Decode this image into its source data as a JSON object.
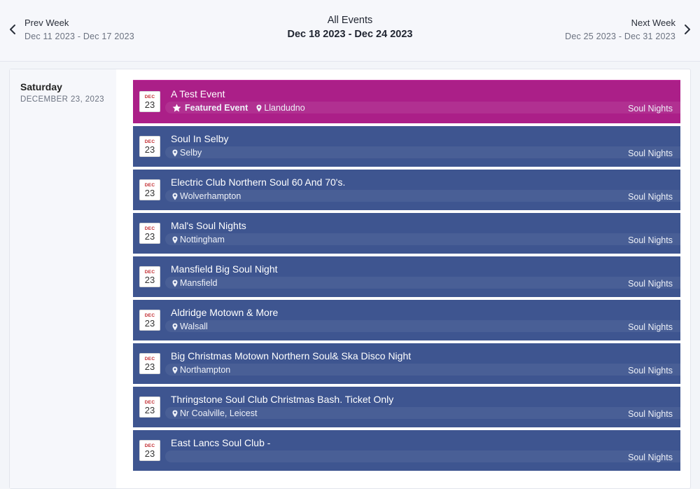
{
  "header": {
    "prev": {
      "label": "Prev Week",
      "range": "Dec 11 2023 - Dec 17 2023"
    },
    "current": {
      "label": "All Events",
      "range": "Dec 18 2023 - Dec 24 2023"
    },
    "next": {
      "label": "Next Week",
      "range": "Dec 25 2023 - Dec 31 2023"
    }
  },
  "day": {
    "name": "Saturday",
    "date": "DECEMBER 23, 2023"
  },
  "featured_label": "Featured Event",
  "colors": {
    "featured": "#ab1f88",
    "event": "#3e5590",
    "calendar_month": "#c0282d"
  },
  "events": [
    {
      "month": "DEC",
      "day": "23",
      "title": "A Test Event",
      "location": "Llandudno",
      "category": "Soul Nights",
      "featured": true
    },
    {
      "month": "DEC",
      "day": "23",
      "title": "Soul In Selby",
      "location": "Selby",
      "category": "Soul Nights",
      "featured": false
    },
    {
      "month": "DEC",
      "day": "23",
      "title": "Electric Club Northern Soul 60 And 70's.",
      "location": "Wolverhampton",
      "category": "Soul Nights",
      "featured": false
    },
    {
      "month": "DEC",
      "day": "23",
      "title": "Mal's Soul Nights",
      "location": "Nottingham",
      "category": "Soul Nights",
      "featured": false
    },
    {
      "month": "DEC",
      "day": "23",
      "title": "Mansfield Big Soul Night",
      "location": "Mansfield",
      "category": "Soul Nights",
      "featured": false
    },
    {
      "month": "DEC",
      "day": "23",
      "title": "Aldridge Motown & More",
      "location": "Walsall",
      "category": "Soul Nights",
      "featured": false
    },
    {
      "month": "DEC",
      "day": "23",
      "title": "Big Christmas Motown Northern Soul& Ska Disco Night",
      "location": "Northampton",
      "category": "Soul Nights",
      "featured": false
    },
    {
      "month": "DEC",
      "day": "23",
      "title": "Thringstone Soul Club Christmas Bash. Ticket Only",
      "location": "Nr Coalville, Leicest",
      "category": "Soul Nights",
      "featured": false
    },
    {
      "month": "DEC",
      "day": "23",
      "title": "East Lancs Soul Club -",
      "location": "",
      "category": "Soul Nights",
      "featured": false
    }
  ]
}
